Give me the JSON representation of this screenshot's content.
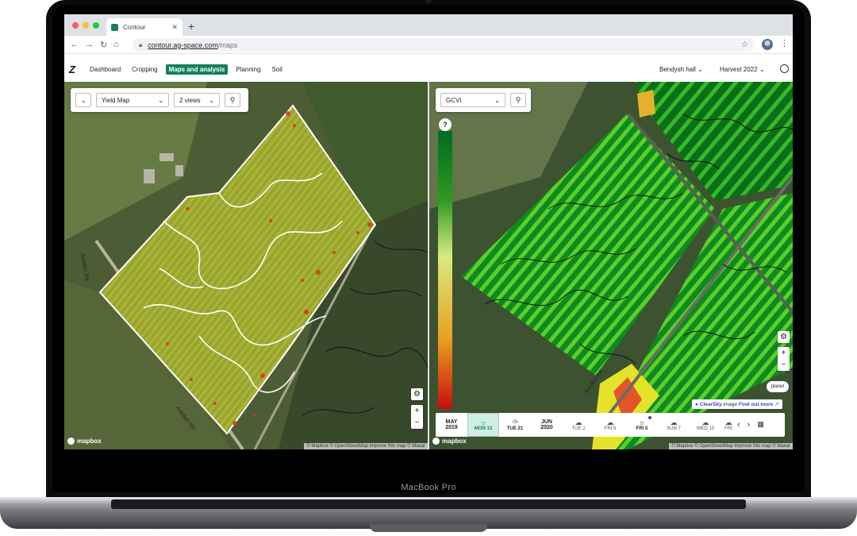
{
  "device": {
    "brand": "MacBook Pro"
  },
  "browser": {
    "tab_title": "Contour",
    "new_tab": "+",
    "url_host": "contour.ag-space.com",
    "url_path": "/maps",
    "icons": [
      "back-arrow-icon",
      "forward-arrow-icon",
      "reload-icon",
      "home-icon",
      "lock-icon",
      "star-icon",
      "kebab-menu-icon"
    ]
  },
  "app": {
    "logo": "Z",
    "nav": [
      "Dashboard",
      "Cropping",
      "Maps and analysis",
      "Planning",
      "Soil"
    ],
    "active_nav": "Maps and analysis",
    "farm": "Bendysh hall",
    "season": "Harvest 2022",
    "accent_color": "#14805c"
  },
  "left_map": {
    "layer_select": "Yield Map",
    "views_select": "2 views",
    "road_labels": [
      "Ashdon Rd",
      "Ashdon Rd"
    ],
    "brand": "mapbox",
    "attribution": "© Mapbox © OpenStreetMap Improve this map © Maxar"
  },
  "right_map": {
    "layer_select": "GCVI",
    "legend_help": "?",
    "road_labels": [
      "Ashdon Rd"
    ],
    "brand": "mapbox",
    "attribution": "© Mapbox © OpenStreetMap Improve this map © Maxar",
    "planet_badge": "planet",
    "clearsky": {
      "name": "ClearSky",
      "text": "image",
      "link": "Find out more"
    },
    "timeline": [
      {
        "top": "MAY",
        "bottom": "2019",
        "kind": "month"
      },
      {
        "icon": "sun-icon",
        "label": "MON 13",
        "kind": "day",
        "selected": true
      },
      {
        "icon": "partly-cloudy-icon",
        "label": "TUE 21",
        "kind": "day"
      },
      {
        "top": "JUN",
        "bottom": "2020",
        "kind": "month"
      },
      {
        "icon": "cloud-icon",
        "label": "TUE 2",
        "kind": "day"
      },
      {
        "icon": "cloud-icon",
        "label": "FRI 5",
        "kind": "day"
      },
      {
        "icon": "sun-icon",
        "label": "FRI 5",
        "kind": "day",
        "new": true
      },
      {
        "icon": "cloud-icon",
        "label": "SUN 7",
        "kind": "day"
      },
      {
        "icon": "cloud-icon",
        "label": "WED 10",
        "kind": "day"
      },
      {
        "icon": "cloud-icon",
        "label": "FRI",
        "kind": "day"
      }
    ]
  },
  "colors": {
    "legend_high": "#006b1e",
    "legend_mid": "#d8ea80",
    "legend_low": "#c70c0c",
    "clearsky": "#4b3ad1"
  }
}
